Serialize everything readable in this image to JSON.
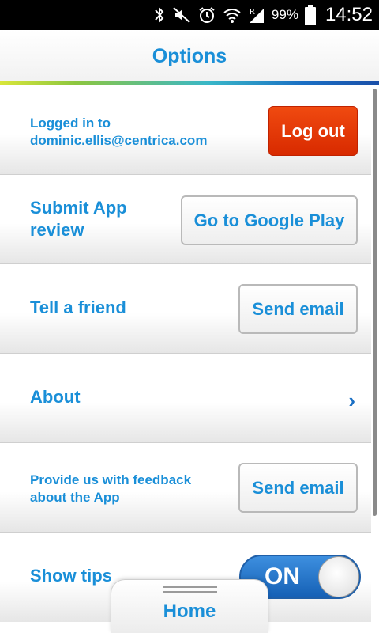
{
  "status_bar": {
    "battery_percent": "99%",
    "time": "14:52",
    "icons": [
      "bluetooth-icon",
      "mute-icon",
      "alarm-icon",
      "wifi-icon",
      "signal-icon",
      "battery-icon"
    ]
  },
  "header": {
    "title": "Options"
  },
  "rows": {
    "login": {
      "text_line1": "Logged in to",
      "text_line2": "dominic.ellis@centrica.com",
      "button": "Log out"
    },
    "review": {
      "label_line1": "Submit App",
      "label_line2": "review",
      "button": "Go to Google Play"
    },
    "friend": {
      "label": "Tell a friend",
      "button": "Send email"
    },
    "about": {
      "label": "About",
      "icon": "chevron-right-icon"
    },
    "feedback": {
      "label_line1": "Provide us with feedback",
      "label_line2": "about the App",
      "button": "Send email"
    },
    "tips": {
      "label": "Show tips",
      "toggle": "ON"
    }
  },
  "bottom_tab": {
    "label": "Home"
  },
  "colors": {
    "accent": "#1a8fd8",
    "logout": "#e03a08",
    "toggle_on": "#1e6fc8"
  }
}
